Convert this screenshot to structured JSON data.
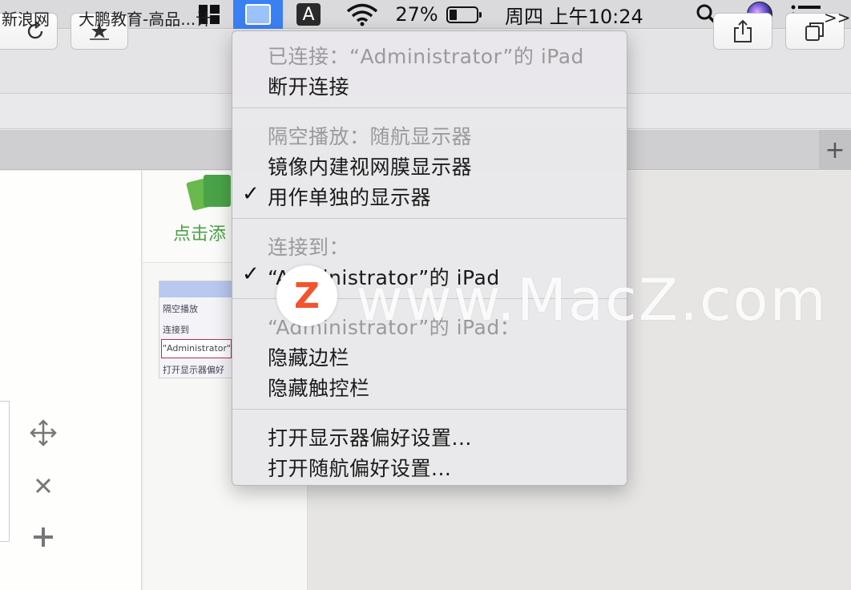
{
  "menubar": {
    "battery_percent": "27%",
    "battery_level": 0.27,
    "clock": "周四 上午10:24",
    "input_source": "A"
  },
  "bookmarks": {
    "items": [
      "新浪网",
      "大鹏教育-高品...计"
    ],
    "overflow": ">>"
  },
  "page": {
    "add_label": "点击添",
    "thumb_lines": [
      "隔空播放",
      "连接到",
      "\"Administrator\"",
      "打开显示器偏好"
    ]
  },
  "menu": {
    "connected_header": "已连接：“Administrator”的 iPad",
    "disconnect": "断开连接",
    "airplay_header": "隔空播放：随航显示器",
    "mirror": "镜像内建视网膜显示器",
    "separate_display": "用作单独的显示器",
    "connect_to_header": "连接到：",
    "device": "“Administrator”的 iPad",
    "device_header": "“Administrator”的 iPad：",
    "hide_sidebar": "隐藏边栏",
    "hide_touchbar": "隐藏触控栏",
    "open_display_prefs": "打开显示器偏好设置...",
    "open_sidecar_prefs": "打开随航偏好设置...",
    "checkmark": "✓"
  },
  "watermark": {
    "logo_letter": "Z",
    "text": "www.MacZ.com"
  },
  "colors": {
    "menu_highlight": "#3b80f3",
    "accent_green": "#4aa346",
    "logo_orange": "#f2542d"
  }
}
